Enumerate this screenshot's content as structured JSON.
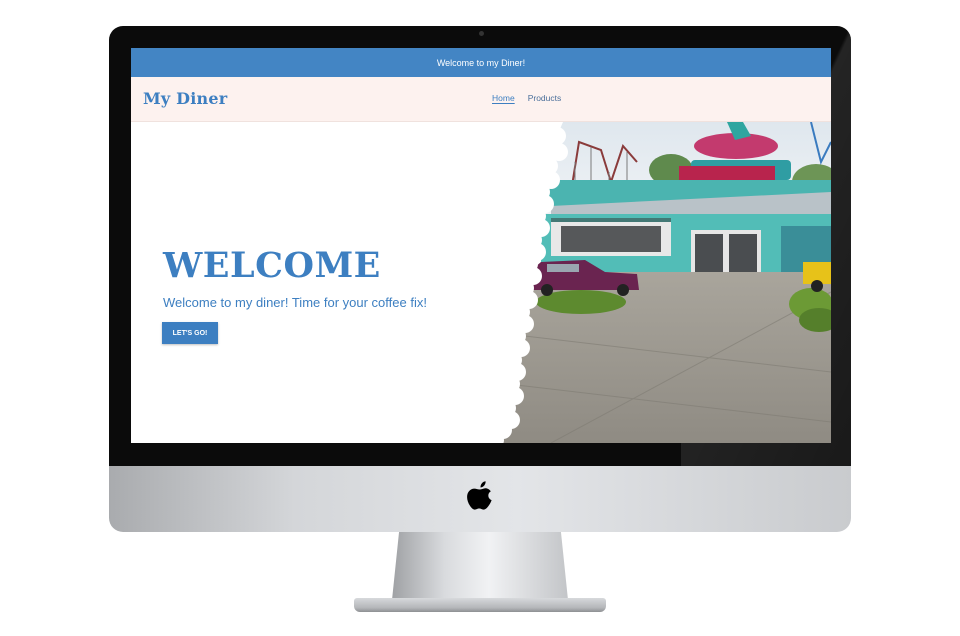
{
  "announcement": {
    "text": "Welcome to my Diner!"
  },
  "header": {
    "brand": "My Diner",
    "nav": [
      {
        "label": "Home",
        "active": true
      },
      {
        "label": "Products",
        "active": false
      }
    ]
  },
  "hero": {
    "title": "WELCOME",
    "subtitle": "Welcome to my diner! Time for your coffee fix!",
    "cta_label": "LET'S GO!",
    "image": {
      "alt": "Retro diner drive-in exterior with vintage cars"
    }
  },
  "colors": {
    "brand_blue": "#3d7fc1",
    "announce_bar": "#4385c4",
    "header_bg": "#fdf2ef"
  },
  "icons": {
    "device_logo": "apple-logo-icon"
  }
}
